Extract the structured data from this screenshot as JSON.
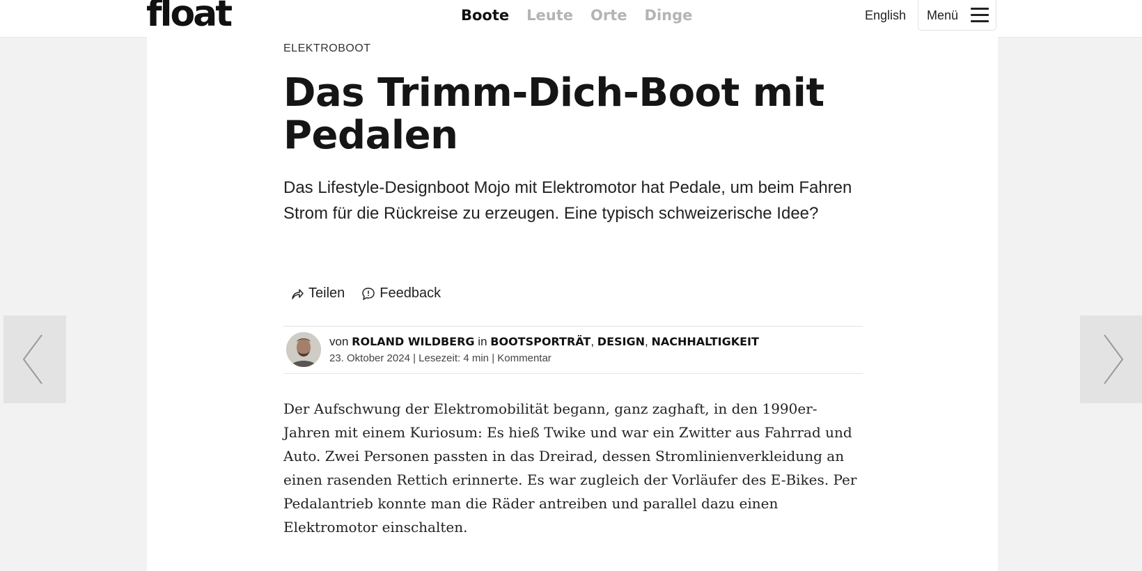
{
  "header": {
    "logo": "float",
    "nav": [
      "Boote",
      "Leute",
      "Orte",
      "Dinge"
    ],
    "active_nav": "Boote",
    "language": "English",
    "menu_label": "Menü"
  },
  "article": {
    "kicker": "ELEKTROBOOT",
    "title": "Das Trimm-Dich-Boot mit Pedalen",
    "lead": "Das Lifestyle-Designboot Mojo mit Elektromotor hat Pedale, um beim Fahren Strom für die Rückreise zu erzeugen. Eine typisch schweizerische Idee?",
    "actions": {
      "share": "Teilen",
      "feedback": "Feedback"
    },
    "byline": {
      "von": "von",
      "author": "ROLAND WILDBERG",
      "in": "in",
      "categories": [
        "BOOTSPORTRÄT",
        "DESIGN",
        "NACHHALTIGKEIT"
      ],
      "separator": ",",
      "meta": "23. Oktober 2024 | Lesezeit: 4 min | Kommentar"
    },
    "body": "Der Aufschwung der Elektromobilität begann, ganz zaghaft, in den 1990er-Jahren mit einem Kuriosum: Es hieß Twike und war ein Zwitter aus Fahrrad und Auto. Zwei Personen passten in das Dreirad, dessen Stromlinienverkleidung an einen rasenden Rettich erinnerte. Es war zugleich der Vorläufer des E-Bikes. Per Pedalantrieb konnte man die Räder antreiben und parallel dazu einen Elektromotor einschalten."
  },
  "icons": {
    "share": "share-arrow-icon",
    "feedback": "speech-bubble-icon",
    "menu": "hamburger-icon",
    "prev": "chevron-left-icon",
    "next": "chevron-right-icon"
  },
  "colors": {
    "nav_inactive": "#b4b4b4",
    "nav_active": "#111111",
    "page_bg": "#f2f2f2",
    "content_bg": "#ffffff"
  }
}
